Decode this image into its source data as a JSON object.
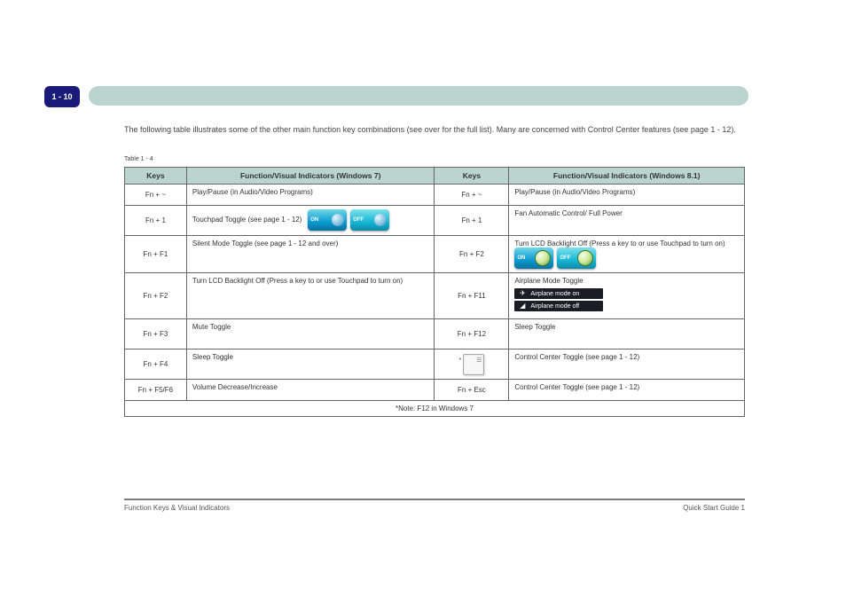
{
  "header": {
    "badge": "1 - 10"
  },
  "intro": {
    "line1": "The following table illustrates some of the other main function key combinations (see over for the full list). Many are concerned",
    "line2": "with Control Center features (see page 1 - 12)."
  },
  "table": {
    "note": "Table 1 - 4",
    "headers": {
      "key": "Keys",
      "fn7": "Function/Visual Indicators (Windows 7)",
      "icon": "Keys",
      "fn81": "Function/Visual Indicators (Windows 8.1)"
    },
    "rows": [
      {
        "key": "Fn + ~",
        "fn7": "Play/Pause (in Audio/Video Programs)",
        "icon_key": "Fn + ~",
        "fn81": "Play/Pause (in Audio/Video Programs)"
      },
      {
        "key": "Fn + 1",
        "fn7_a": "Touchpad Toggle (see page 1 - 12)",
        "chip_on": "ON",
        "chip_off": "OFF",
        "icon_key": "Fn + 1",
        "fn81": "Fan Automatic Control/ Full Power"
      },
      {
        "key": "Fn + F1",
        "fn7": "Silent Mode Toggle (see page 1 - 12 and over)",
        "icon_key": "Fn + F2",
        "fn81_a": "Turn LCD Backlight Off (Press a key to or use Touchpad to turn on)",
        "chip_on": "ON",
        "chip_off": "OFF"
      },
      {
        "key": "Fn + F2",
        "fn7": "Turn LCD Backlight Off (Press a key to or use Touchpad to turn on)",
        "icon_key": "Fn + F11",
        "fn81_a": "Airplane Mode Toggle",
        "ap_on": "Airplane mode on",
        "ap_off": "Airplane mode off"
      },
      {
        "key": "Fn + F3",
        "fn7": "Mute Toggle",
        "icon_key": "Fn + F12",
        "fn81": "Sleep Toggle"
      },
      {
        "key": "Fn + F4",
        "fn7": "Sleep Toggle",
        "icon_key": "*",
        "kbd_glyph": "☰",
        "fn81": "Control Center Toggle (see page 1 - 12)"
      },
      {
        "key": "Fn + F5/F6",
        "fn7": "Volume Decrease/Increase",
        "icon_key": "Fn + Esc",
        "fn81": "Control Center Toggle (see page 1 - 12)"
      }
    ],
    "footer": "*Note: F12 in Windows 7"
  },
  "footer": {
    "left": "Function Keys & Visual Indicators",
    "right": "Quick Start Guide 1"
  }
}
